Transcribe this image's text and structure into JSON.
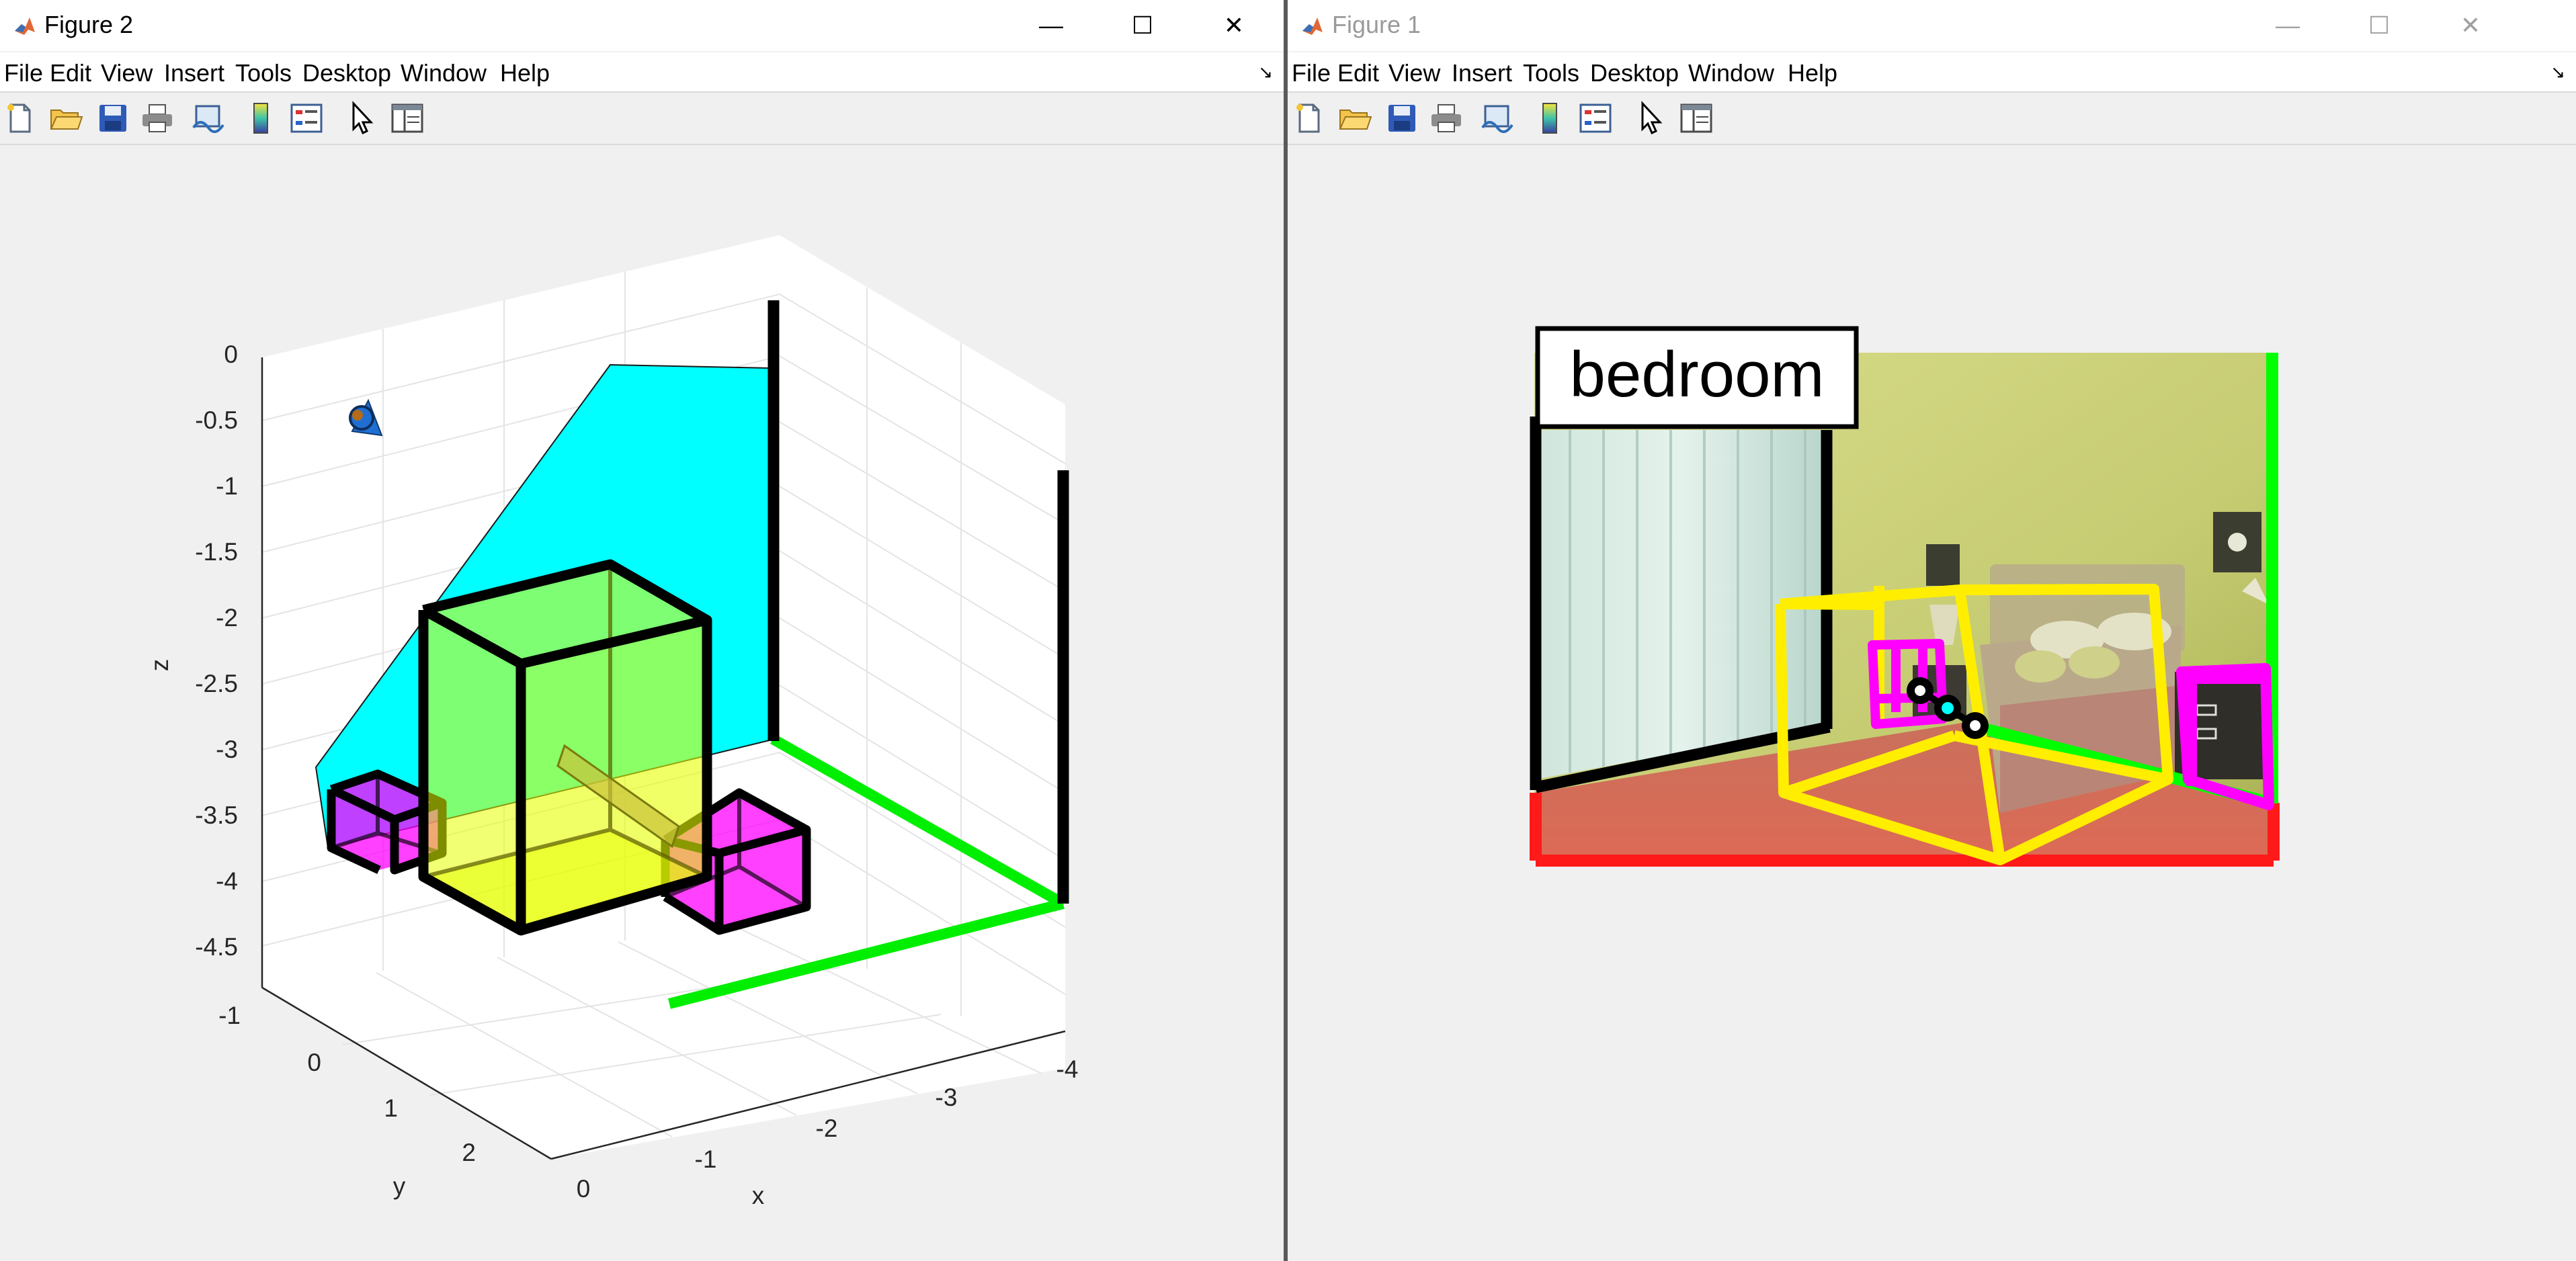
{
  "windows": [
    {
      "title": "Figure 2",
      "active": true,
      "controls": {
        "minimize": "—",
        "maximize": "☐",
        "close": "✕"
      },
      "menu": [
        "File",
        "Edit",
        "View",
        "Insert",
        "Tools",
        "Desktop",
        "Window",
        "Help"
      ],
      "toolbar_icons": [
        "new-figure-icon",
        "open-file-icon",
        "save-icon",
        "print-icon",
        "link-plot-icon",
        "insert-colorbar-icon",
        "insert-legend-icon",
        "edit-plot-icon",
        "property-editor-icon"
      ]
    },
    {
      "title": "Figure 1",
      "active": false,
      "controls": {
        "minimize": "—",
        "maximize": "☐",
        "close": "✕"
      },
      "menu": [
        "File",
        "Edit",
        "View",
        "Insert",
        "Tools",
        "Desktop",
        "Window",
        "Help"
      ],
      "toolbar_icons": [
        "new-figure-icon",
        "open-file-icon",
        "save-icon",
        "print-icon",
        "link-plot-icon",
        "insert-colorbar-icon",
        "insert-legend-icon",
        "edit-plot-icon",
        "property-editor-icon"
      ]
    }
  ],
  "plot3d": {
    "z_label": "z",
    "y_label": "y",
    "x_label": "x",
    "z_ticks": [
      "0",
      "-0.5",
      "-1",
      "-1.5",
      "-2",
      "-2.5",
      "-3",
      "-3.5",
      "-4",
      "-4.5"
    ],
    "y_ticks": [
      "-1",
      "0",
      "1",
      "2"
    ],
    "x_ticks": [
      "0",
      "-1",
      "-2",
      "-3",
      "-4"
    ],
    "colors": {
      "wall": "#00ffff",
      "bed_box": "#e6ff00",
      "nightstand": "#ff00ff",
      "floor_edge": "#00ee00",
      "edge": "#000000"
    }
  },
  "scene_image": {
    "label": "bedroom",
    "colors": {
      "floor": "#ff1a1a",
      "wall_edge": "#00ff00",
      "bed_box": "#ffee00",
      "nightstand": "#ff00ff",
      "window_edge": "#000000"
    }
  }
}
